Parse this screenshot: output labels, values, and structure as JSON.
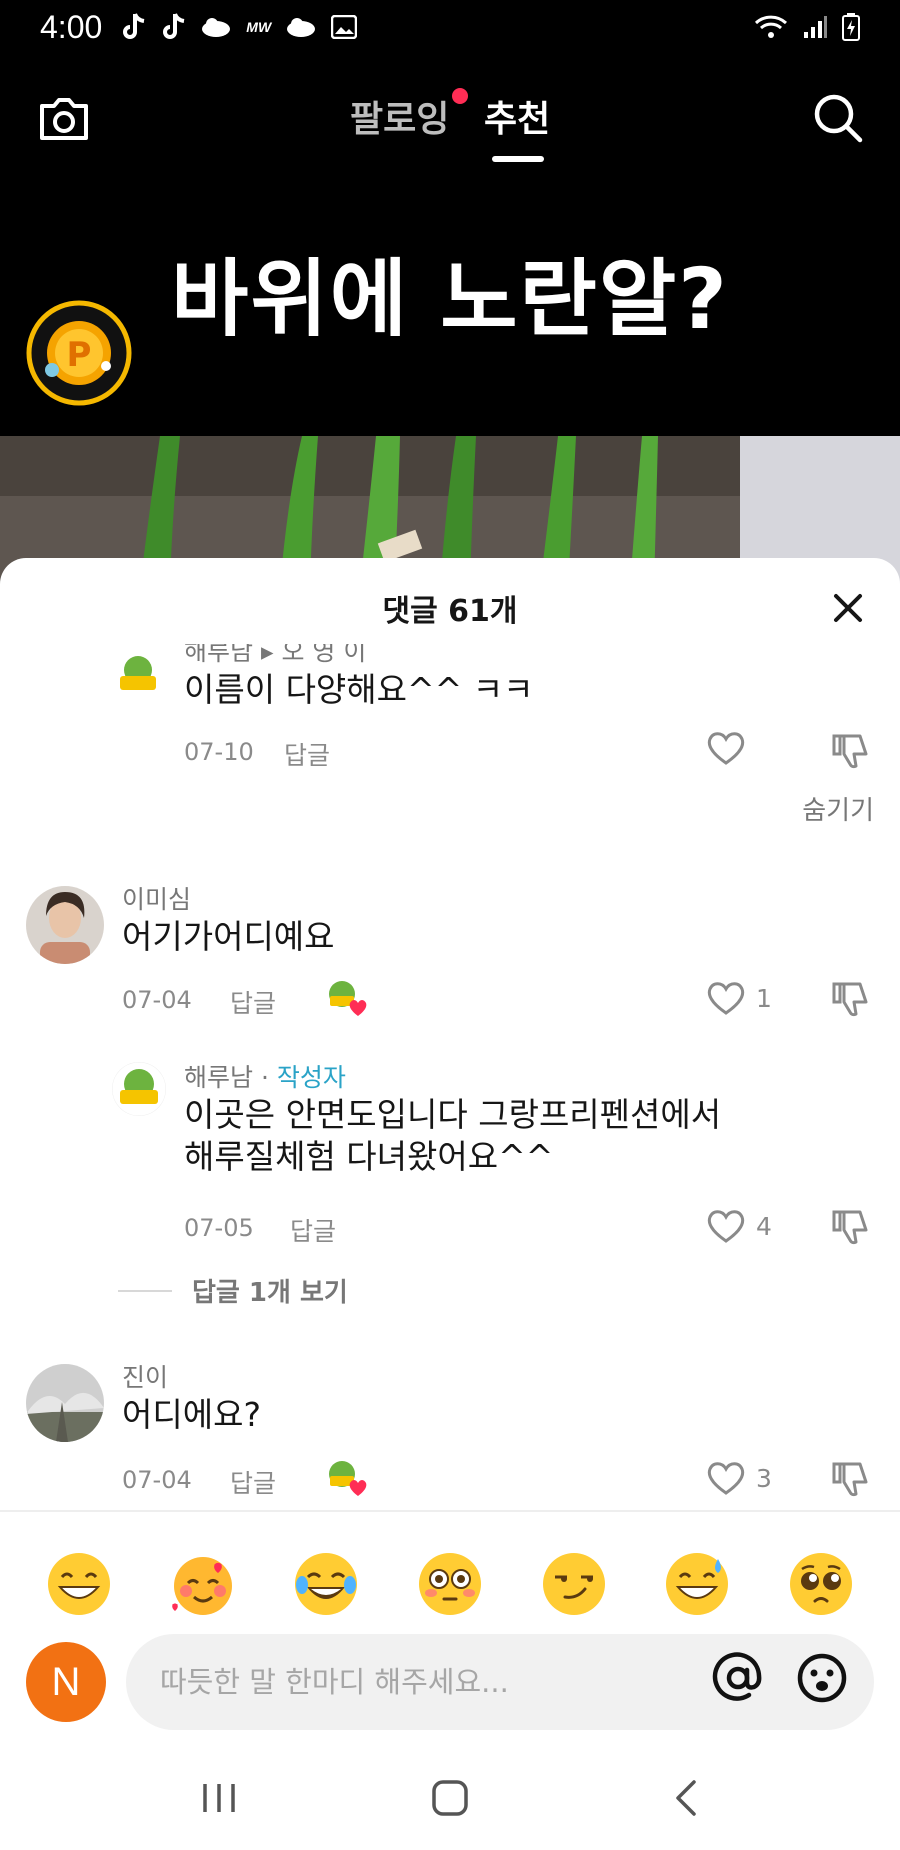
{
  "status_bar": {
    "time": "4:00",
    "mw_label": "MW"
  },
  "top_nav": {
    "tab_following": "팔로잉",
    "tab_recommended": "추천"
  },
  "video": {
    "title": "바위에 노란알?"
  },
  "comments_sheet": {
    "title": "댓글 61개",
    "comments": [
      {
        "name": "해루남 ▸ 오 영 이",
        "text": "이름이 다양해요^^ ㅋㅋ",
        "date": "07-10",
        "reply": "답글",
        "likes": ""
      },
      {
        "name": "이미심",
        "text": "어기가어디예요",
        "date": "07-04",
        "reply": "답글",
        "likes": "1"
      },
      {
        "name": "해루남 · ",
        "author_tag": "작성자",
        "text_line1": "이곳은 안면도입니다 그랑프리펜션에서",
        "text_line2": "해루질체험 다녀왔어요^^",
        "date": "07-05",
        "reply": "답글",
        "likes": "4"
      },
      {
        "name": "진이",
        "text": "어디에요?",
        "date": "07-04",
        "reply": "답글",
        "likes": "3"
      }
    ],
    "hide_label": "숨기기",
    "more_replies": "답글 1개 보기"
  },
  "emoji_bar": [
    "grinning-face",
    "smiling-face-with-hearts",
    "face-with-tears-of-joy",
    "flushed-face",
    "smirking-face",
    "grinning-face-with-sweat",
    "pleading-face"
  ],
  "input": {
    "user_initial": "N",
    "placeholder": "따듯한 말 한마디 해주세요..."
  }
}
